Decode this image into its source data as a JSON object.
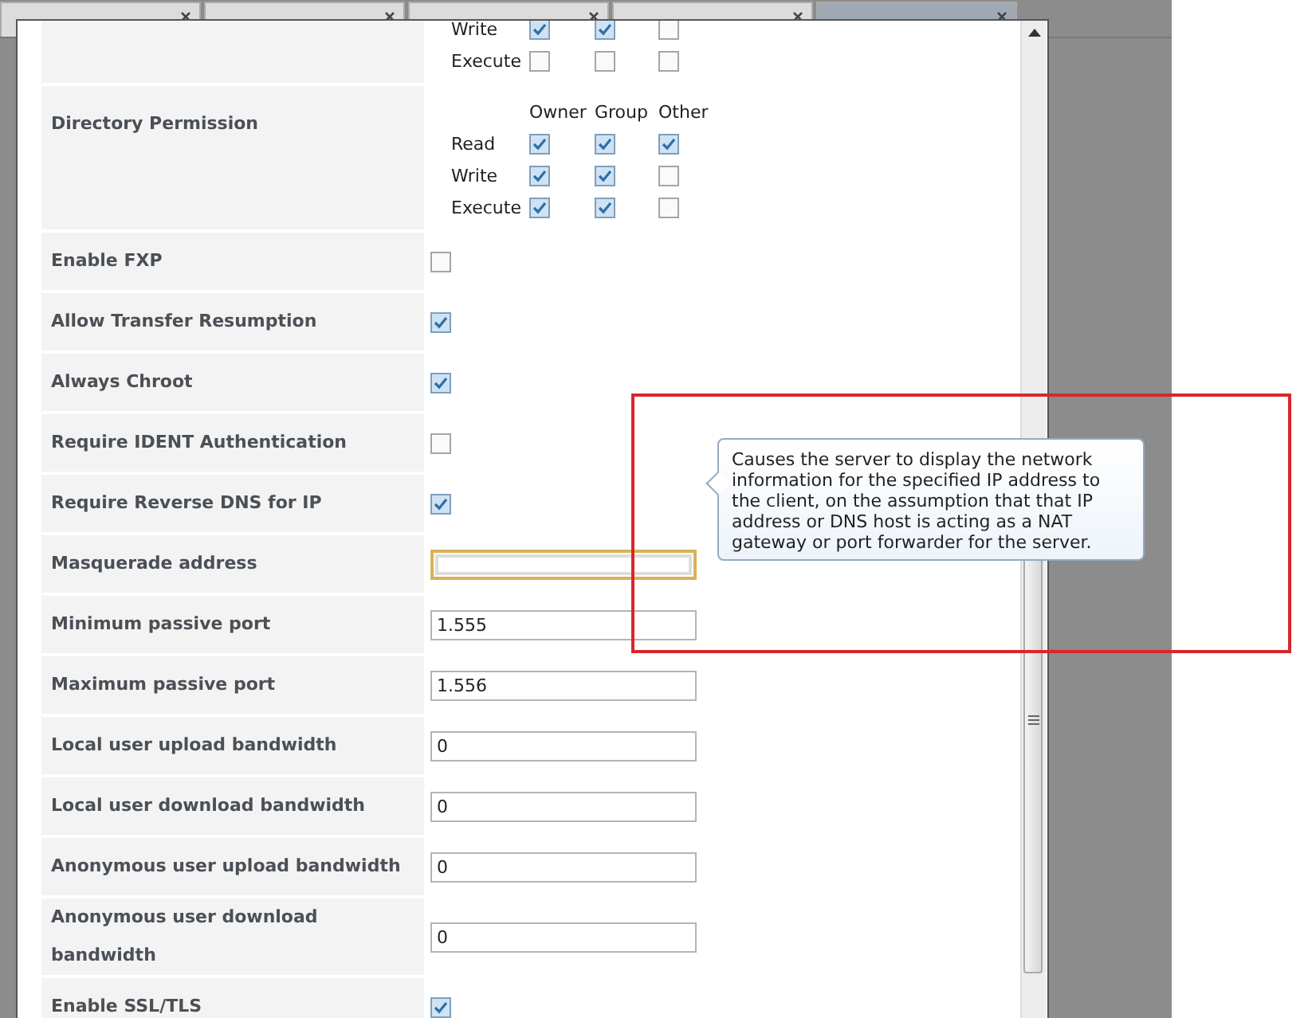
{
  "tabs": [
    {
      "selected": false
    },
    {
      "selected": false
    },
    {
      "selected": false
    },
    {
      "selected": false
    },
    {
      "selected": true
    }
  ],
  "settings": [
    {
      "kind": "permissions",
      "rows": [
        {
          "label": "Write",
          "cells": [
            {
              "checked": true
            },
            {
              "checked": true
            },
            {
              "checked": false
            }
          ]
        },
        {
          "label": "Execute",
          "cells": [
            {
              "checked": false
            },
            {
              "checked": false
            },
            {
              "checked": false
            }
          ]
        }
      ]
    },
    {
      "kind": "permissions",
      "label": "Directory Permission",
      "columns": [
        "Owner",
        "Group",
        "Other"
      ],
      "rows": [
        {
          "label": "Read",
          "cells": [
            {
              "checked": true
            },
            {
              "checked": true
            },
            {
              "checked": true
            }
          ]
        },
        {
          "label": "Write",
          "cells": [
            {
              "checked": true
            },
            {
              "checked": true
            },
            {
              "checked": false
            }
          ]
        },
        {
          "label": "Execute",
          "cells": [
            {
              "checked": true
            },
            {
              "checked": true
            },
            {
              "checked": false
            }
          ]
        }
      ]
    },
    {
      "kind": "checkbox",
      "label": "Enable FXP",
      "checked": false
    },
    {
      "kind": "checkbox",
      "label": "Allow Transfer Resumption",
      "checked": true
    },
    {
      "kind": "checkbox",
      "label": "Always Chroot",
      "checked": true
    },
    {
      "kind": "checkbox",
      "label": "Require IDENT Authentication",
      "checked": false
    },
    {
      "kind": "checkbox",
      "label": "Require Reverse DNS for IP",
      "checked": true
    },
    {
      "kind": "text",
      "label": "Masquerade address",
      "focused": true
    },
    {
      "kind": "text",
      "label": "Minimum passive port",
      "value": "1.555",
      "focused": false
    },
    {
      "kind": "text",
      "label": "Maximum passive port",
      "value": "1.556",
      "focused": false
    },
    {
      "kind": "text",
      "label": "Local user upload bandwidth",
      "value": "0",
      "focused": false
    },
    {
      "kind": "text",
      "label": "Local user download bandwidth",
      "value": "0",
      "focused": false
    },
    {
      "kind": "text",
      "label": "Anonymous user upload bandwidth",
      "value": "0",
      "focused": false
    },
    {
      "kind": "text",
      "label": "Anonymous user download bandwidth",
      "value": "0",
      "focused": false
    },
    {
      "kind": "checkbox",
      "label": "Enable SSL/TLS",
      "checked": true
    }
  ],
  "tooltip": {
    "text": "Causes the server to display the network information for the specified IP address to the client, on the assumption that that IP address or DNS host is acting as a NAT gateway or port forwarder for the server."
  }
}
